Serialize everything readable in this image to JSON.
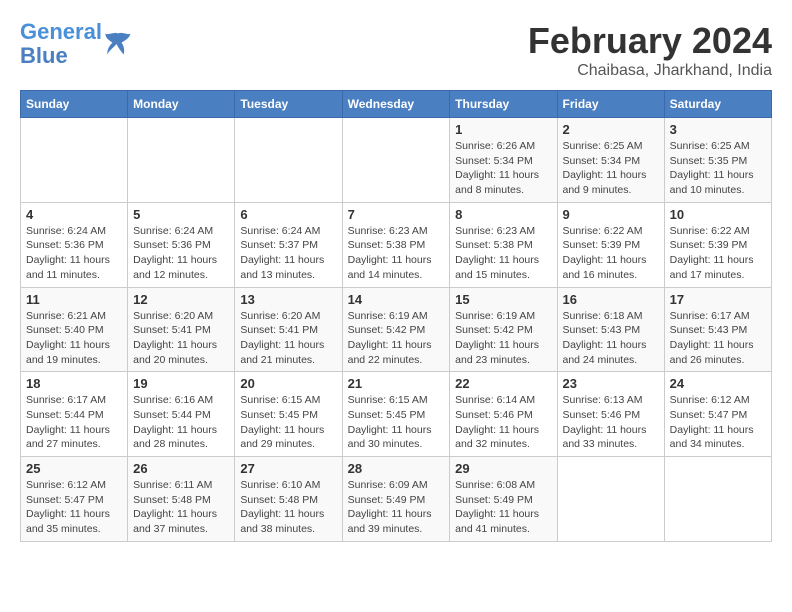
{
  "header": {
    "logo_line1": "General",
    "logo_line2": "Blue",
    "month_title": "February 2024",
    "subtitle": "Chaibasa, Jharkhand, India"
  },
  "calendar": {
    "days_of_week": [
      "Sunday",
      "Monday",
      "Tuesday",
      "Wednesday",
      "Thursday",
      "Friday",
      "Saturday"
    ],
    "weeks": [
      [
        {
          "day": "",
          "info": ""
        },
        {
          "day": "",
          "info": ""
        },
        {
          "day": "",
          "info": ""
        },
        {
          "day": "",
          "info": ""
        },
        {
          "day": "1",
          "info": "Sunrise: 6:26 AM\nSunset: 5:34 PM\nDaylight: 11 hours and 8 minutes."
        },
        {
          "day": "2",
          "info": "Sunrise: 6:25 AM\nSunset: 5:34 PM\nDaylight: 11 hours and 9 minutes."
        },
        {
          "day": "3",
          "info": "Sunrise: 6:25 AM\nSunset: 5:35 PM\nDaylight: 11 hours and 10 minutes."
        }
      ],
      [
        {
          "day": "4",
          "info": "Sunrise: 6:24 AM\nSunset: 5:36 PM\nDaylight: 11 hours and 11 minutes."
        },
        {
          "day": "5",
          "info": "Sunrise: 6:24 AM\nSunset: 5:36 PM\nDaylight: 11 hours and 12 minutes."
        },
        {
          "day": "6",
          "info": "Sunrise: 6:24 AM\nSunset: 5:37 PM\nDaylight: 11 hours and 13 minutes."
        },
        {
          "day": "7",
          "info": "Sunrise: 6:23 AM\nSunset: 5:38 PM\nDaylight: 11 hours and 14 minutes."
        },
        {
          "day": "8",
          "info": "Sunrise: 6:23 AM\nSunset: 5:38 PM\nDaylight: 11 hours and 15 minutes."
        },
        {
          "day": "9",
          "info": "Sunrise: 6:22 AM\nSunset: 5:39 PM\nDaylight: 11 hours and 16 minutes."
        },
        {
          "day": "10",
          "info": "Sunrise: 6:22 AM\nSunset: 5:39 PM\nDaylight: 11 hours and 17 minutes."
        }
      ],
      [
        {
          "day": "11",
          "info": "Sunrise: 6:21 AM\nSunset: 5:40 PM\nDaylight: 11 hours and 19 minutes."
        },
        {
          "day": "12",
          "info": "Sunrise: 6:20 AM\nSunset: 5:41 PM\nDaylight: 11 hours and 20 minutes."
        },
        {
          "day": "13",
          "info": "Sunrise: 6:20 AM\nSunset: 5:41 PM\nDaylight: 11 hours and 21 minutes."
        },
        {
          "day": "14",
          "info": "Sunrise: 6:19 AM\nSunset: 5:42 PM\nDaylight: 11 hours and 22 minutes."
        },
        {
          "day": "15",
          "info": "Sunrise: 6:19 AM\nSunset: 5:42 PM\nDaylight: 11 hours and 23 minutes."
        },
        {
          "day": "16",
          "info": "Sunrise: 6:18 AM\nSunset: 5:43 PM\nDaylight: 11 hours and 24 minutes."
        },
        {
          "day": "17",
          "info": "Sunrise: 6:17 AM\nSunset: 5:43 PM\nDaylight: 11 hours and 26 minutes."
        }
      ],
      [
        {
          "day": "18",
          "info": "Sunrise: 6:17 AM\nSunset: 5:44 PM\nDaylight: 11 hours and 27 minutes."
        },
        {
          "day": "19",
          "info": "Sunrise: 6:16 AM\nSunset: 5:44 PM\nDaylight: 11 hours and 28 minutes."
        },
        {
          "day": "20",
          "info": "Sunrise: 6:15 AM\nSunset: 5:45 PM\nDaylight: 11 hours and 29 minutes."
        },
        {
          "day": "21",
          "info": "Sunrise: 6:15 AM\nSunset: 5:45 PM\nDaylight: 11 hours and 30 minutes."
        },
        {
          "day": "22",
          "info": "Sunrise: 6:14 AM\nSunset: 5:46 PM\nDaylight: 11 hours and 32 minutes."
        },
        {
          "day": "23",
          "info": "Sunrise: 6:13 AM\nSunset: 5:46 PM\nDaylight: 11 hours and 33 minutes."
        },
        {
          "day": "24",
          "info": "Sunrise: 6:12 AM\nSunset: 5:47 PM\nDaylight: 11 hours and 34 minutes."
        }
      ],
      [
        {
          "day": "25",
          "info": "Sunrise: 6:12 AM\nSunset: 5:47 PM\nDaylight: 11 hours and 35 minutes."
        },
        {
          "day": "26",
          "info": "Sunrise: 6:11 AM\nSunset: 5:48 PM\nDaylight: 11 hours and 37 minutes."
        },
        {
          "day": "27",
          "info": "Sunrise: 6:10 AM\nSunset: 5:48 PM\nDaylight: 11 hours and 38 minutes."
        },
        {
          "day": "28",
          "info": "Sunrise: 6:09 AM\nSunset: 5:49 PM\nDaylight: 11 hours and 39 minutes."
        },
        {
          "day": "29",
          "info": "Sunrise: 6:08 AM\nSunset: 5:49 PM\nDaylight: 11 hours and 41 minutes."
        },
        {
          "day": "",
          "info": ""
        },
        {
          "day": "",
          "info": ""
        }
      ]
    ]
  }
}
